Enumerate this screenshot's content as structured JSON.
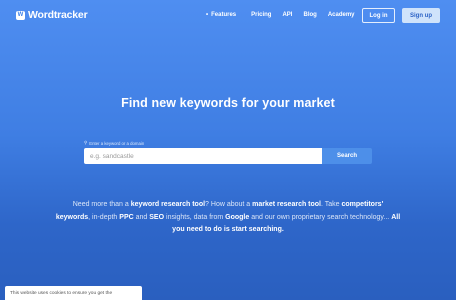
{
  "brand": {
    "logo_glyph": "W",
    "name": "Wordtracker"
  },
  "nav": {
    "features": "Features",
    "pricing": "Pricing",
    "api": "API",
    "blog": "Blog",
    "academy": "Academy",
    "login": "Log in",
    "signup": "Sign up"
  },
  "hero": {
    "title": "Find new keywords for your market"
  },
  "search": {
    "hint": "Enter a keyword or a domain",
    "placeholder": "e.g. sandcastle",
    "value": "",
    "button": "Search"
  },
  "promo": {
    "p1": "Need more than a ",
    "b1": "keyword research tool",
    "p2": "? How about a ",
    "b2": "market research tool",
    "p3": ". Take ",
    "b3": "competitors' keywords",
    "p4": ", in-depth ",
    "b4": "PPC",
    "p5": " and ",
    "b5": "SEO",
    "p6": " insights, data from ",
    "b6": "Google",
    "p7": " and our own proprietary search technology... ",
    "b7": "All you need to do is start searching."
  },
  "cookie": {
    "text": "This website uses cookies to ensure you get the"
  },
  "colors": {
    "background_top": "#4f8ef1",
    "background_bottom": "#2a5fbf",
    "search_button": "#4d8fe9",
    "signup_button": "#cfe3fb"
  },
  "icons": {
    "logo": "wordtracker-logo-icon",
    "nav_bullet": "bullet-icon",
    "search_hint": "magnifier-icon"
  }
}
